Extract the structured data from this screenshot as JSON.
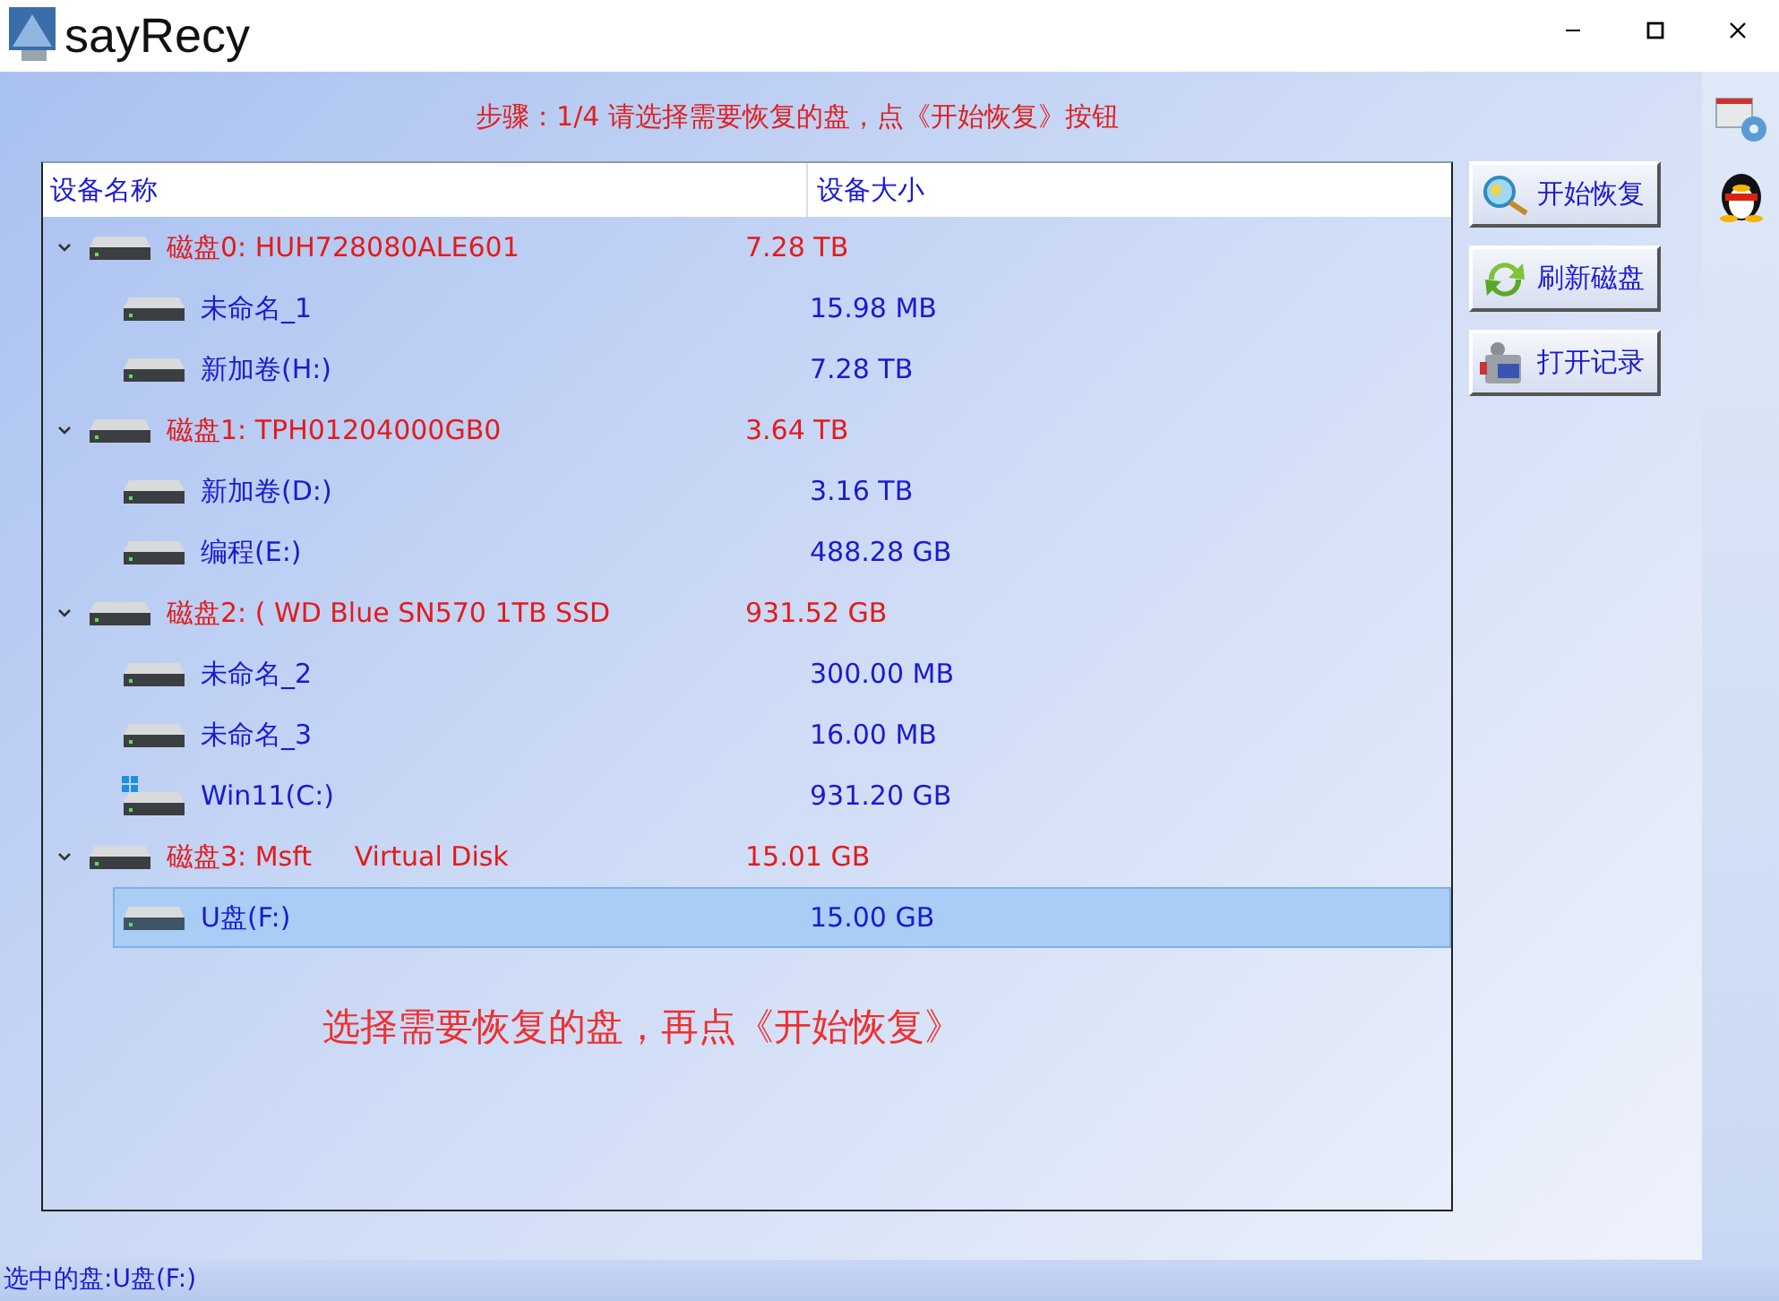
{
  "window": {
    "title": "sayRecy"
  },
  "step_text": "步骤：1/4 请选择需要恢复的盘，点《开始恢复》按钮",
  "table": {
    "columns": [
      "设备名称",
      "设备大小"
    ],
    "disks": [
      {
        "name": "磁盘0: HUH728080ALE601",
        "size": "7.28 TB",
        "expanded": true,
        "selected": false,
        "children": [
          {
            "name": "未命名_1",
            "size": "15.98 MB",
            "kind": "volume",
            "selected": false
          },
          {
            "name": "新加卷(H:)",
            "size": "7.28 TB",
            "kind": "volume",
            "selected": false
          }
        ]
      },
      {
        "name": "磁盘1: TPH01204000GB0",
        "size": "3.64 TB",
        "expanded": true,
        "selected": false,
        "children": [
          {
            "name": "新加卷(D:)",
            "size": "3.16 TB",
            "kind": "volume",
            "selected": false
          },
          {
            "name": "编程(E:)",
            "size": "488.28 GB",
            "kind": "volume",
            "selected": false
          }
        ]
      },
      {
        "name": "磁盘2: ( WD Blue SN570 1TB SSD",
        "size": "931.52 GB",
        "expanded": true,
        "selected": false,
        "children": [
          {
            "name": "未命名_2",
            "size": "300.00 MB",
            "kind": "volume",
            "selected": false
          },
          {
            "name": "未命名_3",
            "size": "16.00 MB",
            "kind": "volume",
            "selected": false
          },
          {
            "name": "Win11(C:)",
            "size": "931.20 GB",
            "kind": "system_volume",
            "selected": false
          }
        ]
      },
      {
        "name": "磁盘3: Msft     Virtual Disk",
        "size": "15.01 GB",
        "expanded": true,
        "selected": false,
        "children": [
          {
            "name": "U盘(F:)",
            "size": "15.00 GB",
            "kind": "volume",
            "selected": true
          }
        ]
      }
    ]
  },
  "buttons": [
    {
      "label": "开始恢复",
      "kind": "search"
    },
    {
      "label": "刷新磁盘",
      "kind": "refresh"
    },
    {
      "label": "打开记录",
      "kind": "camera"
    }
  ],
  "hint": "选择需要恢复的盘，再点《开始恢复》",
  "status_bar": "选中的盘:U盘(F:)"
}
